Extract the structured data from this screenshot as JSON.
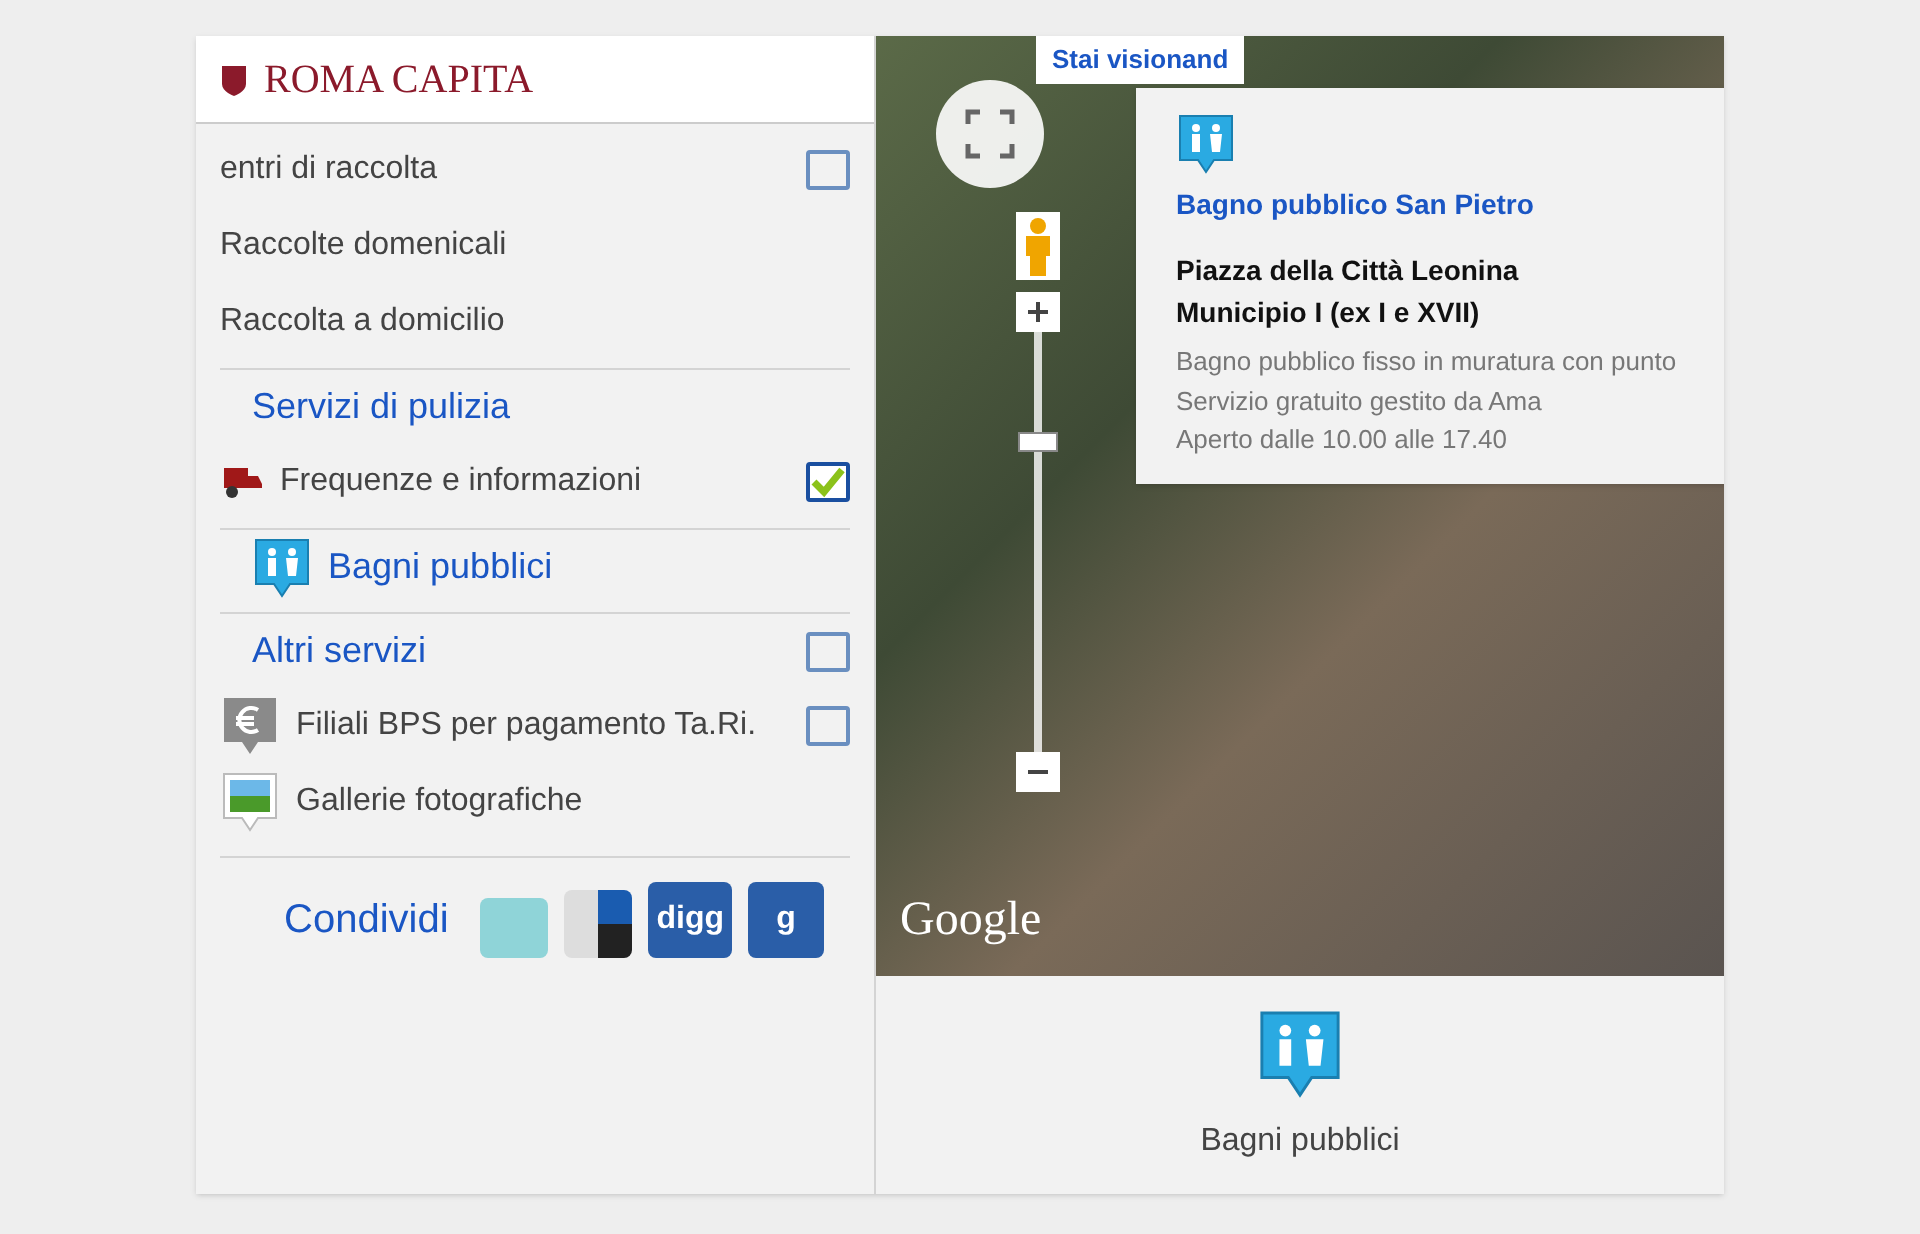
{
  "header": {
    "logo_text": "ROMA CAPITA"
  },
  "sidebar": {
    "items": [
      {
        "kind": "option",
        "label": "entri di raccolta",
        "checked": false
      },
      {
        "kind": "plain",
        "label": "Raccolte domenicali"
      },
      {
        "kind": "plain",
        "label": "Raccolta a domicilio"
      },
      {
        "kind": "section",
        "label": "Servizi di pulizia"
      },
      {
        "kind": "option",
        "label": "Frequenze e informazioni",
        "checked": true
      },
      {
        "kind": "section",
        "label": "Bagni pubblici"
      },
      {
        "kind": "section",
        "label": "Altri servizi",
        "checked": false
      },
      {
        "kind": "option",
        "label": "Filiali BPS per pagamento Ta.Ri.",
        "checked": false
      },
      {
        "kind": "plain",
        "label": "Gallerie fotografiche"
      }
    ],
    "share": {
      "label": "Condividi",
      "buttons": [
        {
          "kind": "blank"
        },
        {
          "kind": "squares"
        },
        {
          "kind": "text",
          "label": "digg"
        },
        {
          "kind": "text",
          "label": "g"
        }
      ]
    }
  },
  "map": {
    "banner": "Stai visionand",
    "zoom": {
      "level": 0.75
    },
    "popup": {
      "title": "Bagno pubblico San Pietro",
      "address": [
        "Piazza della Città Leonina",
        "Municipio I (ex I e XVII)"
      ],
      "details": [
        "Bagno pubblico fisso in muratura con punto",
        "Servizio gratuito gestito da Ama",
        "Aperto dalle 10.00 alle 17.40"
      ]
    },
    "attribution": "Google"
  },
  "legend": {
    "label": "Bagni pubblici"
  }
}
